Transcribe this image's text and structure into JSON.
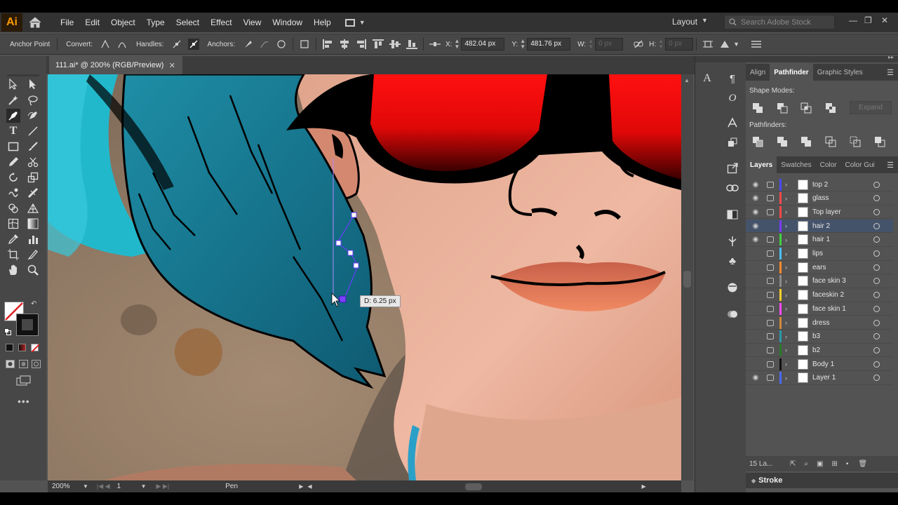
{
  "app": {
    "logo": "Ai"
  },
  "menu": [
    "File",
    "Edit",
    "Object",
    "Type",
    "Select",
    "Effect",
    "View",
    "Window",
    "Help"
  ],
  "workspace": {
    "label": "Layout"
  },
  "search": {
    "placeholder": "Search Adobe Stock"
  },
  "control": {
    "anchor_point": "Anchor Point",
    "convert": "Convert:",
    "handles": "Handles:",
    "anchors": "Anchors:",
    "x_label": "X:",
    "x_value": "482.04 px",
    "y_label": "Y:",
    "y_value": "481.76 px",
    "w_label": "W:",
    "w_value": "0 px",
    "h_label": "H:",
    "h_value": "0 px"
  },
  "document": {
    "tab": "111.ai* @ 200% (RGB/Preview)"
  },
  "status": {
    "zoom": "200%",
    "artboard": "1",
    "tool": "Pen"
  },
  "tooltip": {
    "text": "D: 6.25 px"
  },
  "panels": {
    "top_tabs": [
      "Align",
      "Pathfinder",
      "Graphic Styles"
    ],
    "shape_modes": "Shape Modes:",
    "expand": "Expand",
    "pathfinders": "Pathfinders:",
    "layer_tabs": [
      "Layers",
      "Swatches",
      "Color",
      "Color Gui"
    ],
    "layers": [
      {
        "name": "top 2",
        "color": "#4a4aff",
        "visible": true
      },
      {
        "name": "glass",
        "color": "#ff4a4a",
        "visible": true
      },
      {
        "name": "Top layer",
        "color": "#ff4a4a",
        "visible": true
      },
      {
        "name": "hair 2",
        "color": "#7a3cff",
        "visible": true
      },
      {
        "name": "hair 1",
        "color": "#40d040",
        "visible": true
      },
      {
        "name": "lips",
        "color": "#4ac0ff",
        "visible": false
      },
      {
        "name": "ears",
        "color": "#ff8a2a",
        "visible": false
      },
      {
        "name": "face skin 3",
        "color": "#8a8a8a",
        "visible": false
      },
      {
        "name": "faceskin 2",
        "color": "#ffd02a",
        "visible": false
      },
      {
        "name": "face skin 1",
        "color": "#ff4aff",
        "visible": false
      },
      {
        "name": "dress",
        "color": "#d08a3a",
        "visible": false
      },
      {
        "name": "b3",
        "color": "#2a9aaa",
        "visible": false
      },
      {
        "name": "b2",
        "color": "#2a7a2a",
        "visible": false
      },
      {
        "name": "Body 1",
        "color": "#111111",
        "visible": false
      },
      {
        "name": "Layer 1",
        "color": "#4a6aff",
        "visible": true
      }
    ],
    "layer_count": "15 La...",
    "stroke": "Stroke"
  }
}
